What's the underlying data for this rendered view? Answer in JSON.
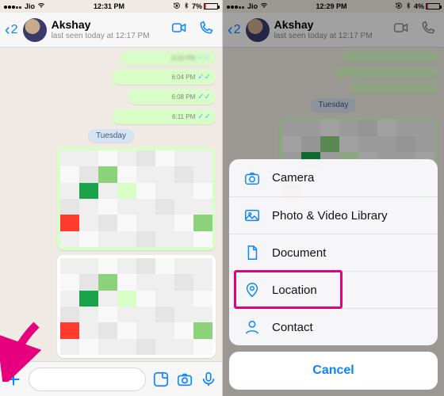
{
  "left": {
    "status": {
      "carrier": "Jio",
      "time": "12:31 PM",
      "battery_pct": "7%"
    },
    "header": {
      "back_count": "2",
      "name": "Akshay",
      "subtitle": "last seen today at 12:17 PM"
    },
    "messages": {
      "times": [
        "6:04 PM",
        "6:04 PM",
        "6:08 PM",
        "6:11 PM"
      ],
      "day_label": "Tuesday"
    }
  },
  "right": {
    "status": {
      "carrier": "Jio",
      "time": "12:29 PM",
      "battery_pct": "4%"
    },
    "header": {
      "back_count": "2",
      "name": "Akshay",
      "subtitle": "last seen today at 12:17 PM"
    },
    "sheet": {
      "items": [
        "Camera",
        "Photo & Video Library",
        "Document",
        "Location",
        "Contact"
      ],
      "cancel": "Cancel"
    }
  },
  "colors": {
    "ios_blue": "#0a84ff",
    "highlight": "#e6007e"
  }
}
